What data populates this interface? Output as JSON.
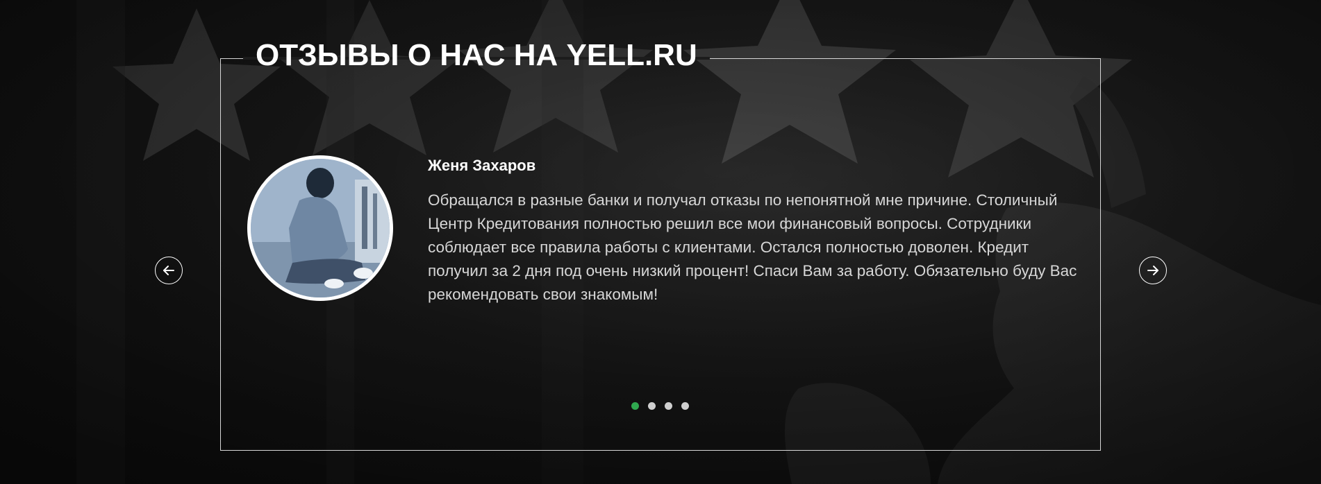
{
  "section": {
    "title": "ОТЗЫВЫ О НАС НА YELL.RU"
  },
  "review": {
    "name": "Женя Захаров",
    "text": "Обращался в разные банки и получал отказы по непонятной мне причине. Столичный Центр Кредитования полностью решил все мои финансовый вопросы. Сотрудники соблюдает все правила работы с клиентами. Остался полностью доволен. Кредит получил за 2 дня под очень низкий процент! Спаси Вам за работу. Обязательно буду Вас рекомендовать свои знакомым!"
  },
  "carousel": {
    "prev_icon": "arrow-left-icon",
    "next_icon": "arrow-right-icon",
    "slide_count": 4,
    "active_slide": 1
  },
  "colors": {
    "accent_dot": "#2fa84f",
    "inactive_dot": "#cfcfcf",
    "frame": "#d8d8d8",
    "text": "#ffffff"
  }
}
